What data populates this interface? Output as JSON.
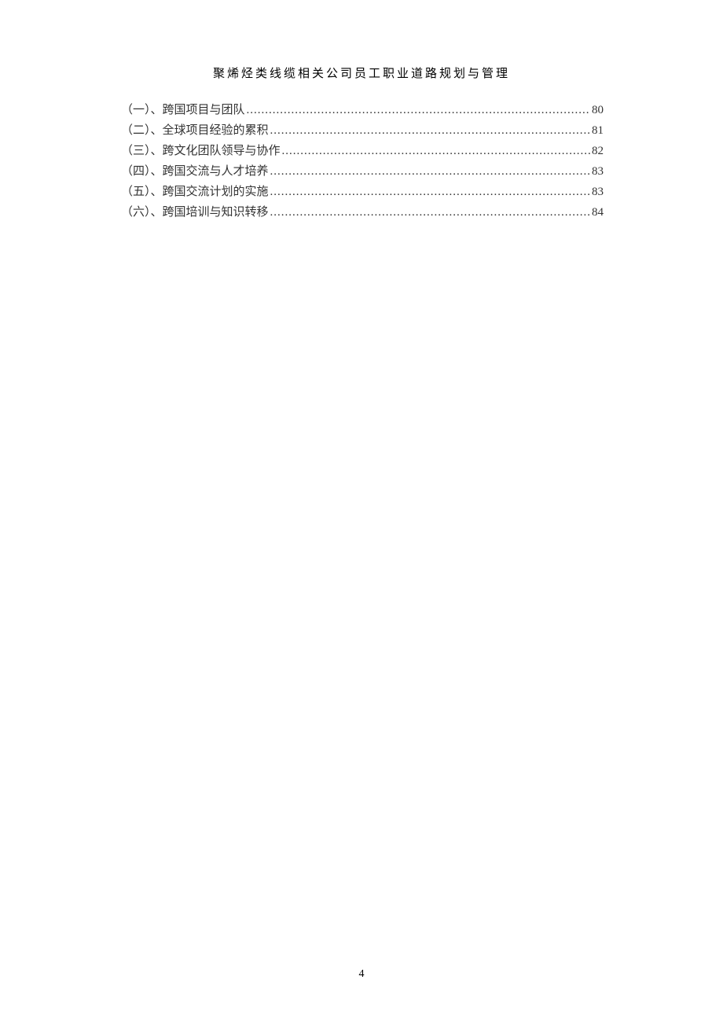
{
  "header": {
    "title": "聚烯烃类线缆相关公司员工职业道路规划与管理"
  },
  "toc": {
    "entries": [
      {
        "label": "（一）、跨国项目与团队",
        "page": "80"
      },
      {
        "label": "（二）、全球项目经验的累积",
        "page": "81"
      },
      {
        "label": "（三）、跨文化团队领导与协作",
        "page": "82"
      },
      {
        "label": "（四）、跨国交流与人才培养",
        "page": "83"
      },
      {
        "label": "（五）、跨国交流计划的实施",
        "page": "83"
      },
      {
        "label": "（六）、跨国培训与知识转移",
        "page": "84"
      }
    ]
  },
  "footer": {
    "page_number": "4"
  }
}
